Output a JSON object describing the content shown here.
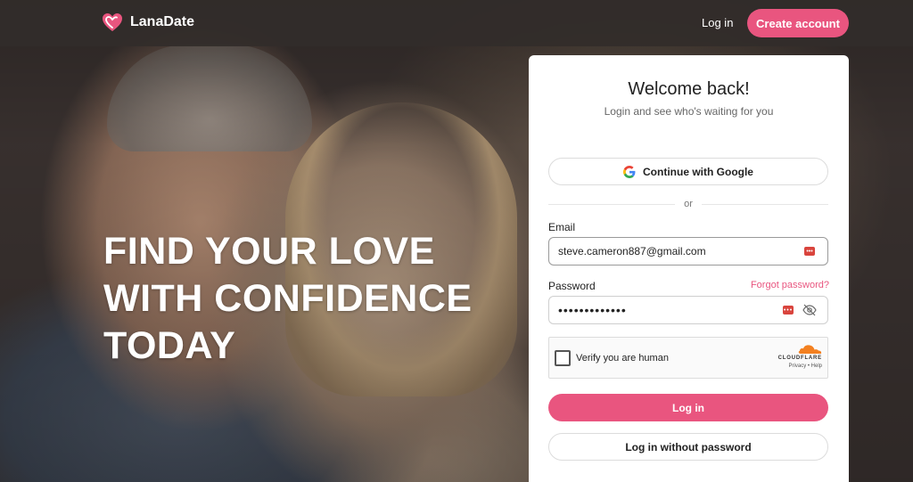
{
  "header": {
    "brand_name": "LanaDate",
    "login_link": "Log in",
    "create_account": "Create account"
  },
  "hero": {
    "headline_lines": [
      "FIND YOUR LOVE",
      "WITH CONFIDENCE",
      "TODAY"
    ]
  },
  "login_card": {
    "title": "Welcome back!",
    "subtitle": "Login and see who's waiting for you",
    "google_button": "Continue with Google",
    "divider_text": "or",
    "email_label": "Email",
    "email_value": "steve.cameron887@gmail.com",
    "password_label": "Password",
    "forgot_password": "Forgot password?",
    "password_value": "•••••••••••••",
    "captcha": {
      "label": "Verify you are human",
      "provider": "CLOUDFLARE",
      "links": "Privacy  •  Help"
    },
    "login_button": "Log in",
    "passwordless_button": "Log in without password"
  },
  "colors": {
    "accent": "#e9557f",
    "nav_bg": "#322c2a",
    "card_bg": "#ffffff"
  },
  "icons": [
    "heart-logo-icon",
    "google-icon",
    "password-manager-icon",
    "eye-off-icon",
    "cloudflare-icon"
  ]
}
